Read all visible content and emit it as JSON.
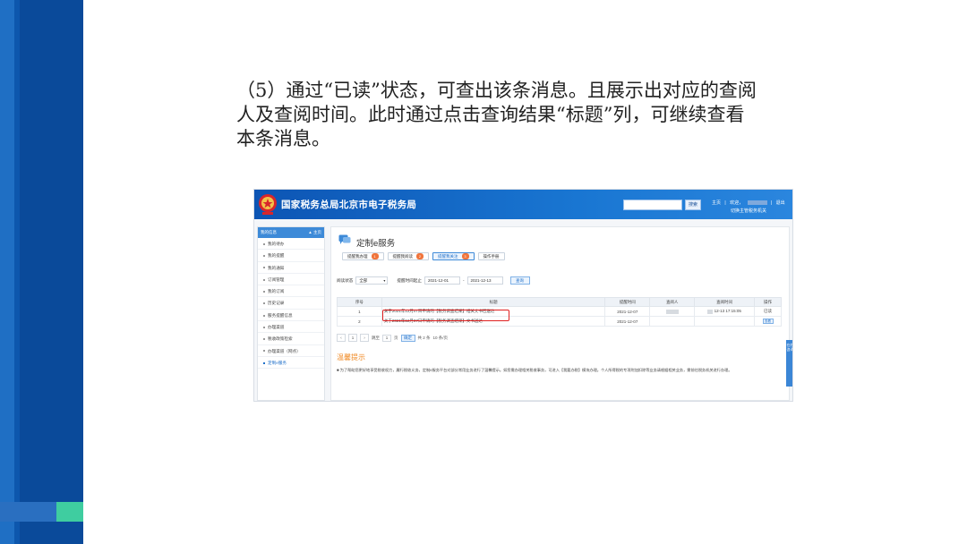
{
  "paragraph": {
    "line1": "（5）通过“已读”状态，可查出该条消息。且展示出对应的查阅",
    "line2": "人及查阅时间。此时通过点击查询结果“标题”列，可继续查看",
    "line3": "本条消息。"
  },
  "colors": {
    "left_band": "#0a4a9a",
    "accent_green": "#3fcda0",
    "header_blue": "#1565c0",
    "highlight_red": "#e02020",
    "tip_orange": "#f08a24"
  },
  "screenshot": {
    "header": {
      "title": "国家税务总局北京市电子税务局",
      "search_button": "搜索",
      "link_home": "主页",
      "link_welcome": "欢迎，",
      "link_sep": "|",
      "link_exit": "退出",
      "sub_link": "切换主管税务机关",
      "emblem_icon": "tax-emblem-icon"
    },
    "sidebar": {
      "head_label": "我的信息",
      "head_home": "▲ 主页",
      "items": [
        {
          "label": "我的待办"
        },
        {
          "label": "我的提醒"
        },
        {
          "label": "我的通知"
        },
        {
          "label": "订阅管理"
        },
        {
          "label": "我的订阅"
        },
        {
          "label": "历史记录"
        },
        {
          "label": "服务提醒信息"
        },
        {
          "label": "办理渠道"
        },
        {
          "label": "税收政策检索"
        },
        {
          "label": "办理渠道（网点）"
        },
        {
          "label": "定制e服务"
        }
      ]
    },
    "main": {
      "service_title": "定制e服务",
      "service_icon": "chat-bubble-icon",
      "tabs": [
        {
          "label": "提醒我办理",
          "badge": "1"
        },
        {
          "label": "提醒我阅读",
          "badge": "2"
        },
        {
          "label": "提醒我关注",
          "badge": "3"
        },
        {
          "label": "操作手册",
          "badge": ""
        }
      ],
      "filters": {
        "status_label": "阅读状态",
        "status_value": "全部",
        "time_label": "提醒时间起止",
        "date_from": "2021-12-01",
        "date_sep": "-",
        "date_to": "2021-12-13",
        "query_button": "查询"
      },
      "table": {
        "headers": [
          "序号",
          "标题",
          "提醒时间",
          "查阅人",
          "查阅时间",
          "操作"
        ],
        "rows": [
          {
            "no": "1",
            "title": "关于2021年12月07日申请的【税务调查结果】相关文书已送达",
            "time": "2021-12-07",
            "reader": "",
            "read_time": "12-13 17:15:05",
            "op": "已读",
            "op_button": "查看"
          },
          {
            "no": "2",
            "title": "关于2021年12月07日申请的【税务调查结果】文书送达",
            "time": "2021-12-07",
            "reader": "",
            "read_time": "",
            "op": "",
            "op_button": ""
          }
        ]
      },
      "pager": {
        "first": "‹",
        "prev": "1",
        "next": "›",
        "goto_label": "跳至",
        "page_value": "1",
        "page_unit": "页",
        "go_button": "确定",
        "total": "共 2 条",
        "per_page": "10 条/页"
      },
      "tips": {
        "title": "温馨提示",
        "text": "■ 为了帮助您更好地享受税收权力，履行税收义务，定制e服务平台对部分常用业务进行了温馨提示。如您需办理相关税收事务，可进入【我要办税】模块办理。个人所得税的专项附加扣除等业务请根据相关业务，需前往税务机关进行办理。"
      }
    },
    "float_tab": "在线咨询"
  }
}
